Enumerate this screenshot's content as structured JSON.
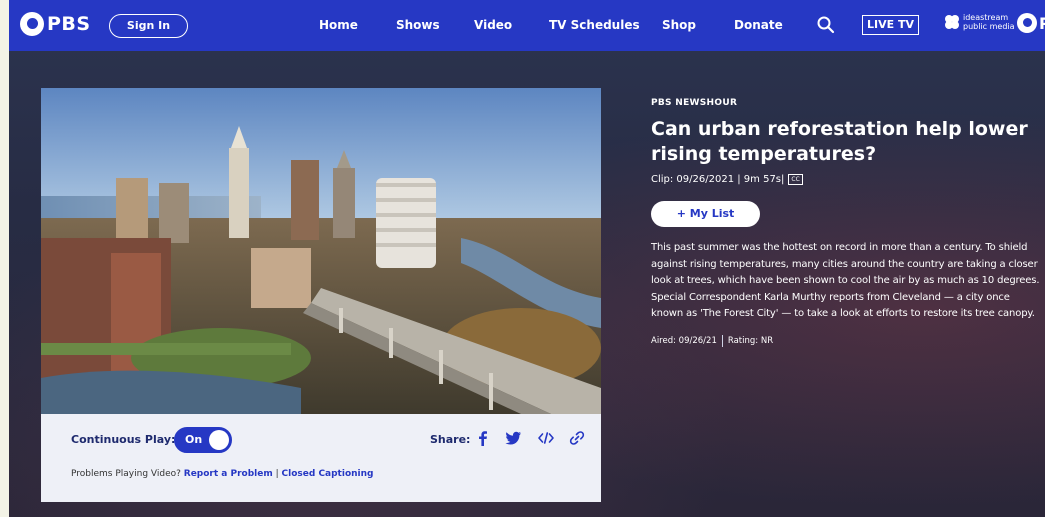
{
  "nav": {
    "logo_text": "PBS",
    "sign_in": "Sign In",
    "links": [
      "Home",
      "Shows",
      "Video",
      "TV Schedules",
      "Shop",
      "Donate"
    ],
    "live_tv": "LIVE TV",
    "station_line1": "ideastream",
    "station_line2": "public media",
    "pbs_partial": "P"
  },
  "player": {
    "continuous_play_label": "Continuous Play:",
    "toggle_text": "On",
    "share_label": "Share:",
    "share_icons": [
      "facebook-icon",
      "twitter-icon",
      "embed-icon",
      "link-icon"
    ],
    "problems_text": "Problems Playing Video?",
    "report_link": "Report a Problem",
    "divider": "|",
    "cc_link": "Closed Captioning"
  },
  "video": {
    "show": "PBS NEWSHOUR",
    "title": "Can urban reforestation help lower rising temperatures?",
    "clip_info": "Clip: 09/26/2021 | 9m 57s|",
    "cc_badge": "CC",
    "my_list": "+ My List",
    "description": "This past summer was the hottest on record in more than a century. To shield against rising temperatures, many cities around the country are taking a closer look at trees, which have been shown to cool the air by as much as 10 degrees. Special Correspondent Karla Murthy reports from Cleveland — a city once known as 'The Forest City' — to take a look at efforts to restore its tree canopy.",
    "aired": "Aired: 09/26/21",
    "rating": "Rating: NR"
  },
  "colors": {
    "pbs_blue": "#2638c4",
    "background": "#2a2f48"
  }
}
